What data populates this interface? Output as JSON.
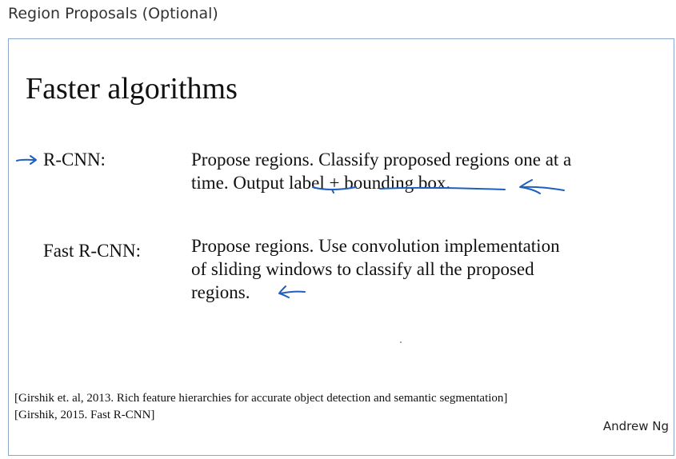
{
  "header": {
    "title": "Region Proposals (Optional)"
  },
  "slide": {
    "title": "Faster algorithms",
    "items": [
      {
        "term": "R-CNN:",
        "desc_lines": [
          "Propose regions. Classify proposed regions one at a",
          "time. Output label + bounding box."
        ]
      },
      {
        "term": "Fast R-CNN:",
        "desc_lines": [
          "Propose regions. Use convolution implementation",
          "of sliding windows to classify all the proposed",
          "regions."
        ]
      }
    ],
    "references": [
      "[Girshik et. al, 2013. Rich feature hierarchies for accurate object detection and semantic segmentation]",
      "[Girshik, 2015. Fast R-CNN]"
    ],
    "author": "Andrew Ng"
  },
  "ink_color": "#1f5fbf"
}
